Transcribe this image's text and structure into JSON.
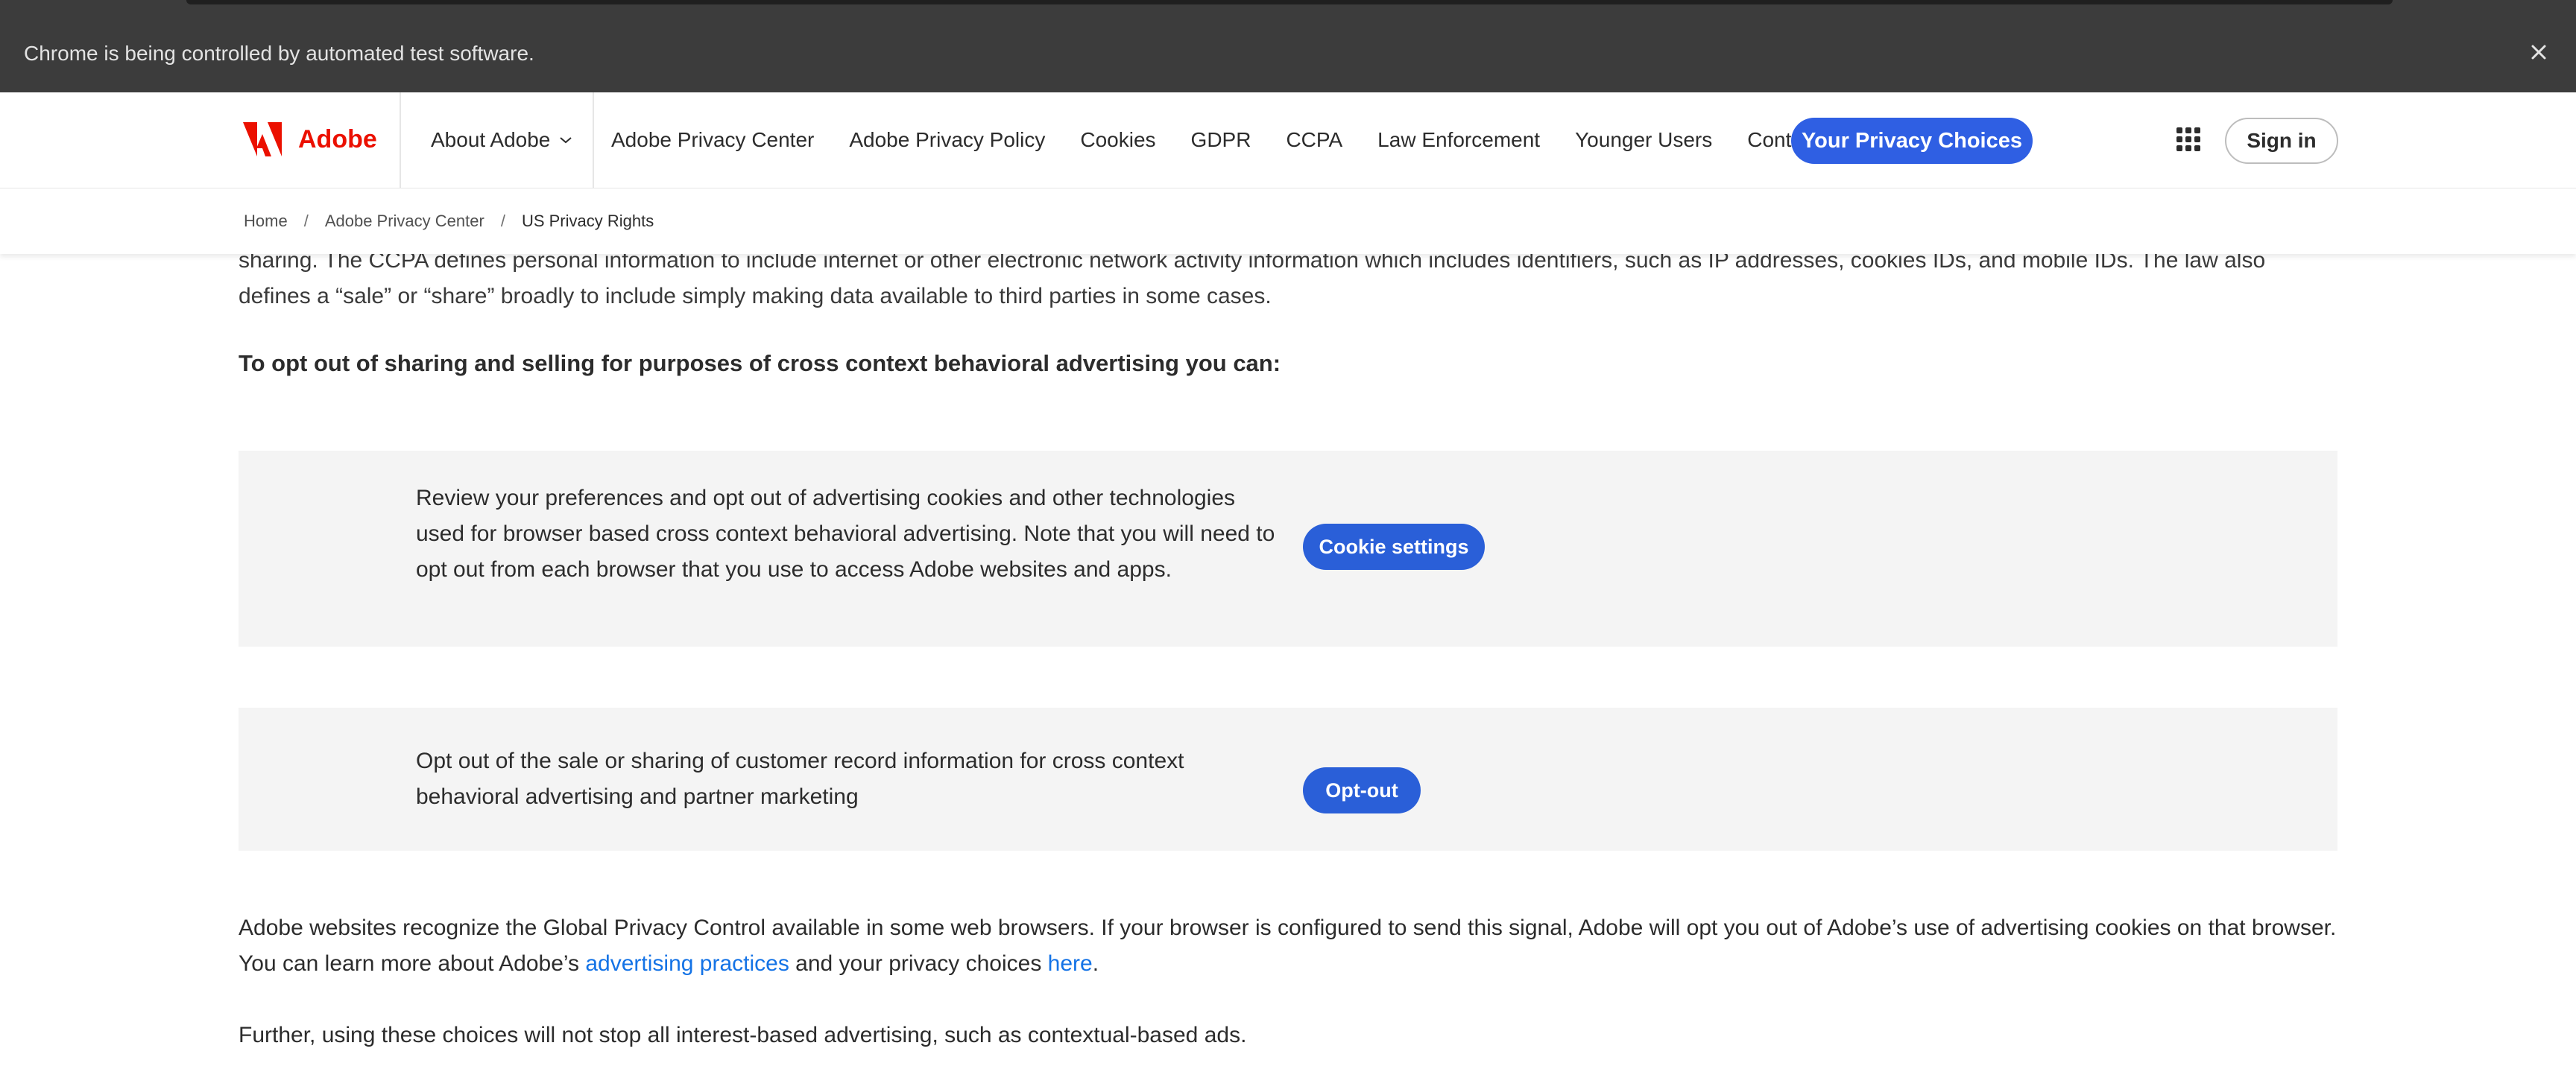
{
  "infobar": {
    "message": "Chrome is being controlled by automated test software.",
    "close_icon": "close-icon"
  },
  "nav": {
    "brand": "Adobe",
    "about": "About Adobe",
    "links": [
      "Adobe Privacy Center",
      "Adobe Privacy Policy",
      "Cookies",
      "GDPR",
      "CCPA",
      "Law Enforcement",
      "Younger Users",
      "Contact Us"
    ],
    "privacy_choices": "Your Privacy Choices",
    "sign_in": "Sign in",
    "accent": "#2f5fe3",
    "brand_color": "#eb1000"
  },
  "breadcrumb": {
    "home": "Home",
    "privacy_center": "Adobe Privacy Center",
    "current": "US Privacy Rights"
  },
  "content": {
    "intro": "sharing. The CCPA defines personal information to include internet or other electronic network activity information which includes identifiers, such as IP addresses, cookies IDs, and mobile IDs. The law also defines a “sale” or “share” broadly to include simply making data available to third parties in some cases.",
    "heading": "To opt out of sharing and selling for purposes of cross context behavioral advertising you can:",
    "card1_text": "Review your preferences and opt out of advertising cookies and other technologies used for browser based cross context behavioral advertising. Note that you will need to opt out from each browser that you use to access Adobe websites and apps.",
    "card1_button": "Cookie settings",
    "card2_text": "Opt out of the sale or sharing of customer record information for cross context behavioral advertising and partner marketing",
    "card2_button": "Opt-out",
    "gpc_part1": "Adobe websites recognize the Global Privacy Control available in some web browsers. If your browser is configured to send this signal, Adobe will opt you out of Adobe’s use of advertising cookies on that browser. You can learn more about Adobe’s ",
    "gpc_link1": "advertising practices",
    "gpc_part2": " and your privacy choices ",
    "gpc_link2": "here",
    "gpc_part3": ".",
    "further": "Further, using these choices will not stop all interest-based advertising, such as contextual-based ads."
  }
}
